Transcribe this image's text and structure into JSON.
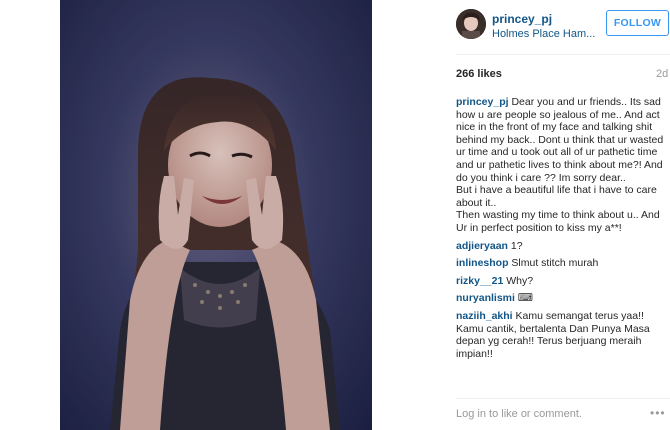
{
  "post": {
    "username": "princey_pj",
    "location": "Holmes Place Ham...",
    "follow_label": "FOLLOW",
    "likes": "266 likes",
    "time_ago": "2d",
    "caption": "Dear you and ur friends.. Its sad how u are people so jealous of me.. And act nice in the front of my face and talking shit behind my back.. Dont u think that ur wasted ur time and u took out all of ur pathetic time and ur pathetic lives to think about me?! And do you think i care ?? Im sorry dear..\nBut i have a beautiful life that i have to care about it..\nThen wasting my time to think about u.. And Ur in perfect position to kiss my a**!"
  },
  "comments": [
    {
      "user": "adjieryaan",
      "text": "1?"
    },
    {
      "user": "inlineshop",
      "text": "Slmut stitch murah"
    },
    {
      "user": "rizky__21",
      "text": "Why?"
    },
    {
      "user": "nuryanlismi",
      "text": "⌨"
    },
    {
      "user": "naziih_akhi",
      "text": "Kamu semangat terus yaa!! Kamu cantik, bertalenta Dan Punya Masa depan yg cerah!! Terus berjuang meraih impian!!"
    }
  ],
  "footer": {
    "login_text": "Log in to like or comment.",
    "more_icon": "ellipsis-icon",
    "more_glyph": "•••"
  },
  "colors": {
    "link_blue": "#125688",
    "button_blue": "#3897f0",
    "muted_gray": "#999999"
  }
}
